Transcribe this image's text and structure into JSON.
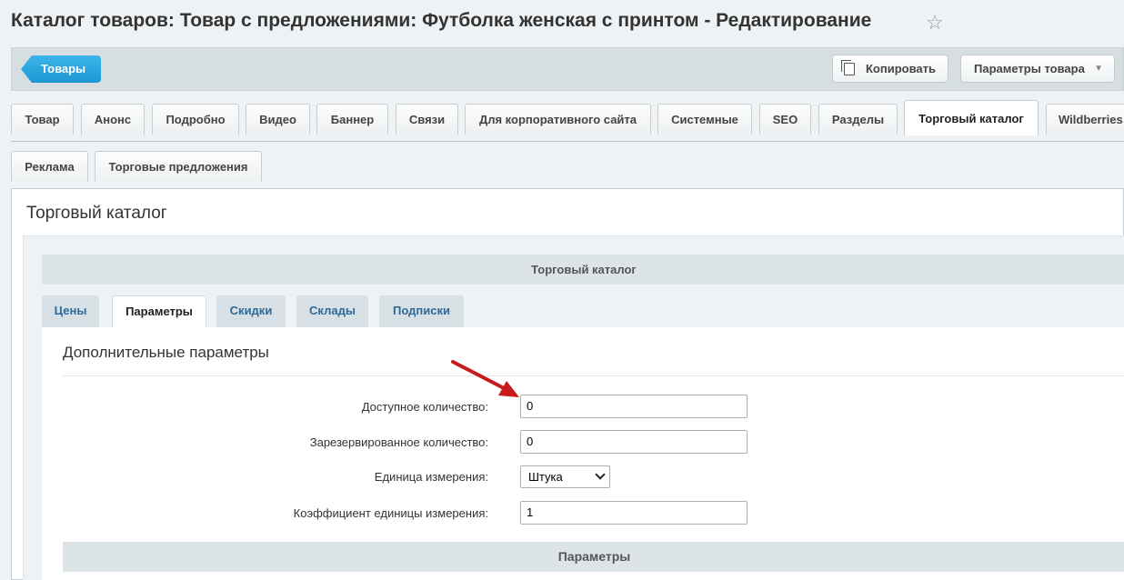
{
  "page": {
    "title": "Каталог товаров: Товар с предложениями: Футболка женская с принтом - Редактирование",
    "star_icon": "star-icon"
  },
  "toolbar": {
    "back_label": "Товары",
    "copy_label": "Копировать",
    "params_label": "Параметры товара"
  },
  "tabs": [
    "Товар",
    "Анонс",
    "Подробно",
    "Видео",
    "Баннер",
    "Связи",
    "Для корпоративного сайта",
    "Системные",
    "SEO",
    "Разделы",
    "Торговый каталог",
    "Wildberries"
  ],
  "tabs_row2": [
    "Реклама",
    "Торговые предложения"
  ],
  "active_tab": "Торговый каталог",
  "content": {
    "section_title": "Торговый каталог",
    "header_bar": "Торговый каталог",
    "subtabs": [
      "Цены",
      "Параметры",
      "Скидки",
      "Склады",
      "Подписки"
    ],
    "active_subtab": "Параметры",
    "panel_title": "Дополнительные параметры",
    "fields": {
      "available_label": "Доступное количество:",
      "available_value": "0",
      "reserved_label": "Зарезервированное количество:",
      "reserved_value": "0",
      "unit_label": "Единица измерения:",
      "unit_value": "Штука",
      "ratio_label": "Коэффициент единицы измерения:",
      "ratio_value": "1"
    },
    "params_bar": "Параметры"
  },
  "colors": {
    "accent": "#1e98d4",
    "arrow": "#c8191b",
    "link": "#2e6a99"
  }
}
